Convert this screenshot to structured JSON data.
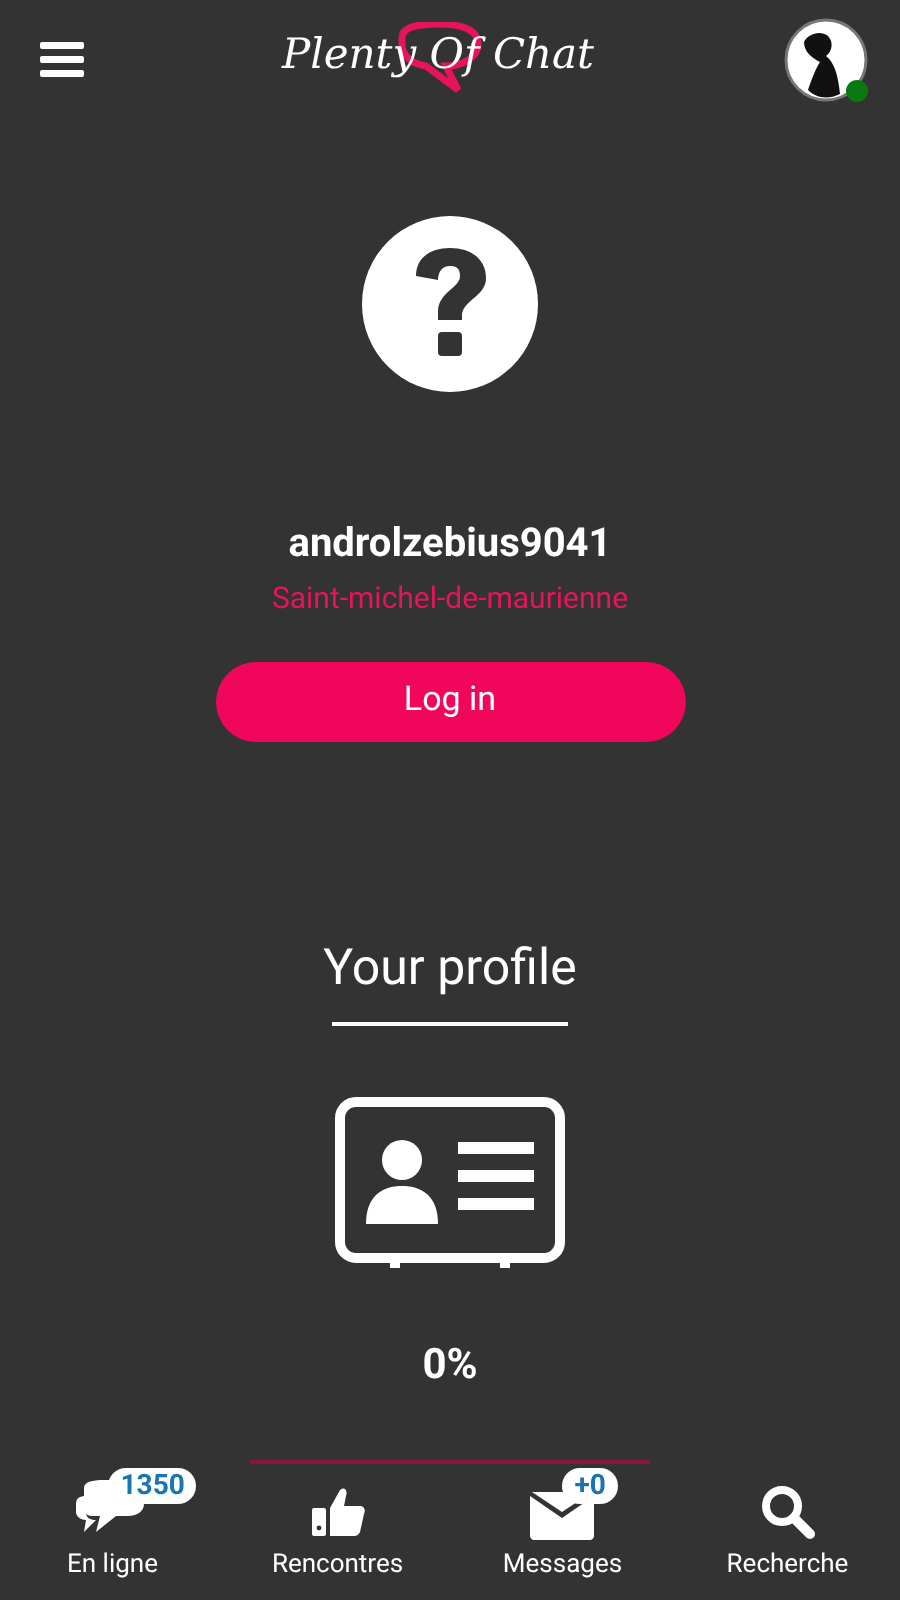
{
  "header": {
    "logo": "Plenty Of Chat",
    "avatar_online": true
  },
  "profile": {
    "username": "androlzebius9041",
    "location": "Saint-michel-de-maurienne",
    "login_button": "Log in"
  },
  "your_profile": {
    "title": "Your profile",
    "completion": "0%",
    "level": 0
  },
  "bottom_nav": [
    {
      "kind": "chat",
      "label": "En ligne",
      "badge": "1350"
    },
    {
      "kind": "like",
      "label": "Rencontres"
    },
    {
      "kind": "mail",
      "label": "Messages",
      "badge": "+0"
    },
    {
      "kind": "search",
      "label": "Recherche"
    }
  ]
}
